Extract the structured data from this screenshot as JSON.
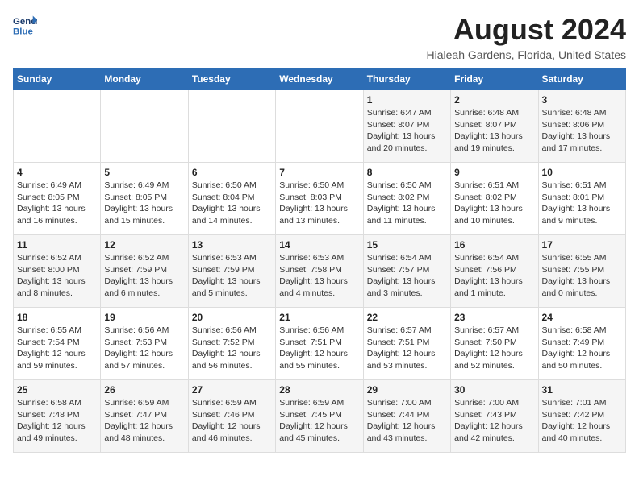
{
  "logo": {
    "line1": "General",
    "line2": "Blue"
  },
  "title": "August 2024",
  "subtitle": "Hialeah Gardens, Florida, United States",
  "days_of_week": [
    "Sunday",
    "Monday",
    "Tuesday",
    "Wednesday",
    "Thursday",
    "Friday",
    "Saturday"
  ],
  "weeks": [
    [
      {
        "day": "",
        "info": ""
      },
      {
        "day": "",
        "info": ""
      },
      {
        "day": "",
        "info": ""
      },
      {
        "day": "",
        "info": ""
      },
      {
        "day": "1",
        "info": "Sunrise: 6:47 AM\nSunset: 8:07 PM\nDaylight: 13 hours\nand 20 minutes."
      },
      {
        "day": "2",
        "info": "Sunrise: 6:48 AM\nSunset: 8:07 PM\nDaylight: 13 hours\nand 19 minutes."
      },
      {
        "day": "3",
        "info": "Sunrise: 6:48 AM\nSunset: 8:06 PM\nDaylight: 13 hours\nand 17 minutes."
      }
    ],
    [
      {
        "day": "4",
        "info": "Sunrise: 6:49 AM\nSunset: 8:05 PM\nDaylight: 13 hours\nand 16 minutes."
      },
      {
        "day": "5",
        "info": "Sunrise: 6:49 AM\nSunset: 8:05 PM\nDaylight: 13 hours\nand 15 minutes."
      },
      {
        "day": "6",
        "info": "Sunrise: 6:50 AM\nSunset: 8:04 PM\nDaylight: 13 hours\nand 14 minutes."
      },
      {
        "day": "7",
        "info": "Sunrise: 6:50 AM\nSunset: 8:03 PM\nDaylight: 13 hours\nand 13 minutes."
      },
      {
        "day": "8",
        "info": "Sunrise: 6:50 AM\nSunset: 8:02 PM\nDaylight: 13 hours\nand 11 minutes."
      },
      {
        "day": "9",
        "info": "Sunrise: 6:51 AM\nSunset: 8:02 PM\nDaylight: 13 hours\nand 10 minutes."
      },
      {
        "day": "10",
        "info": "Sunrise: 6:51 AM\nSunset: 8:01 PM\nDaylight: 13 hours\nand 9 minutes."
      }
    ],
    [
      {
        "day": "11",
        "info": "Sunrise: 6:52 AM\nSunset: 8:00 PM\nDaylight: 13 hours\nand 8 minutes."
      },
      {
        "day": "12",
        "info": "Sunrise: 6:52 AM\nSunset: 7:59 PM\nDaylight: 13 hours\nand 6 minutes."
      },
      {
        "day": "13",
        "info": "Sunrise: 6:53 AM\nSunset: 7:59 PM\nDaylight: 13 hours\nand 5 minutes."
      },
      {
        "day": "14",
        "info": "Sunrise: 6:53 AM\nSunset: 7:58 PM\nDaylight: 13 hours\nand 4 minutes."
      },
      {
        "day": "15",
        "info": "Sunrise: 6:54 AM\nSunset: 7:57 PM\nDaylight: 13 hours\nand 3 minutes."
      },
      {
        "day": "16",
        "info": "Sunrise: 6:54 AM\nSunset: 7:56 PM\nDaylight: 13 hours\nand 1 minute."
      },
      {
        "day": "17",
        "info": "Sunrise: 6:55 AM\nSunset: 7:55 PM\nDaylight: 13 hours\nand 0 minutes."
      }
    ],
    [
      {
        "day": "18",
        "info": "Sunrise: 6:55 AM\nSunset: 7:54 PM\nDaylight: 12 hours\nand 59 minutes."
      },
      {
        "day": "19",
        "info": "Sunrise: 6:56 AM\nSunset: 7:53 PM\nDaylight: 12 hours\nand 57 minutes."
      },
      {
        "day": "20",
        "info": "Sunrise: 6:56 AM\nSunset: 7:52 PM\nDaylight: 12 hours\nand 56 minutes."
      },
      {
        "day": "21",
        "info": "Sunrise: 6:56 AM\nSunset: 7:51 PM\nDaylight: 12 hours\nand 55 minutes."
      },
      {
        "day": "22",
        "info": "Sunrise: 6:57 AM\nSunset: 7:51 PM\nDaylight: 12 hours\nand 53 minutes."
      },
      {
        "day": "23",
        "info": "Sunrise: 6:57 AM\nSunset: 7:50 PM\nDaylight: 12 hours\nand 52 minutes."
      },
      {
        "day": "24",
        "info": "Sunrise: 6:58 AM\nSunset: 7:49 PM\nDaylight: 12 hours\nand 50 minutes."
      }
    ],
    [
      {
        "day": "25",
        "info": "Sunrise: 6:58 AM\nSunset: 7:48 PM\nDaylight: 12 hours\nand 49 minutes."
      },
      {
        "day": "26",
        "info": "Sunrise: 6:59 AM\nSunset: 7:47 PM\nDaylight: 12 hours\nand 48 minutes."
      },
      {
        "day": "27",
        "info": "Sunrise: 6:59 AM\nSunset: 7:46 PM\nDaylight: 12 hours\nand 46 minutes."
      },
      {
        "day": "28",
        "info": "Sunrise: 6:59 AM\nSunset: 7:45 PM\nDaylight: 12 hours\nand 45 minutes."
      },
      {
        "day": "29",
        "info": "Sunrise: 7:00 AM\nSunset: 7:44 PM\nDaylight: 12 hours\nand 43 minutes."
      },
      {
        "day": "30",
        "info": "Sunrise: 7:00 AM\nSunset: 7:43 PM\nDaylight: 12 hours\nand 42 minutes."
      },
      {
        "day": "31",
        "info": "Sunrise: 7:01 AM\nSunset: 7:42 PM\nDaylight: 12 hours\nand 40 minutes."
      }
    ]
  ]
}
